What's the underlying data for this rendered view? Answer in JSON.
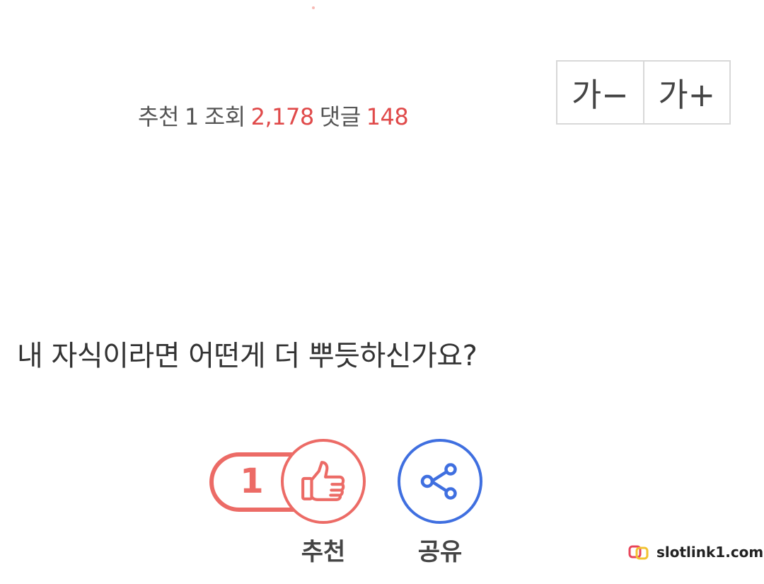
{
  "stats": {
    "like_label": "추천",
    "like_count": "1",
    "view_label": "조회",
    "view_count": "2,178",
    "comment_label": "댓글",
    "comment_count": "148"
  },
  "font_controls": {
    "decrease_label": "가−",
    "increase_label": "가+"
  },
  "post": {
    "question": "내 자식이라면 어떤게 더 뿌듯하신가요?"
  },
  "actions": {
    "like_count": "1",
    "like_label": "추천",
    "share_label": "공유"
  },
  "watermark": {
    "text": "slotlink1.com"
  },
  "colors": {
    "accent_red": "#ec6b66",
    "accent_blue": "#3f6fe0",
    "count_red": "#e04a4a"
  },
  "icons": {
    "like": "thumbs-up-icon",
    "share": "share-icon",
    "watermark_logo": "link-logo-icon"
  }
}
